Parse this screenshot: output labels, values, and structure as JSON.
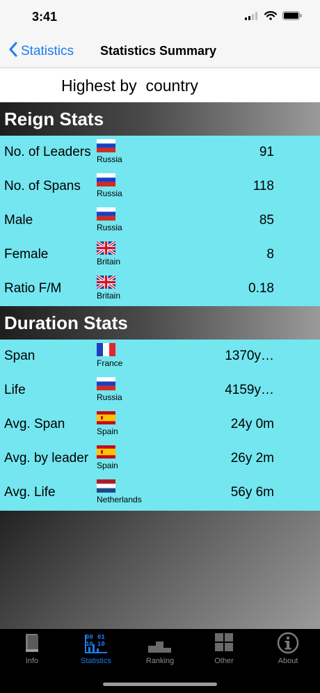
{
  "status": {
    "time": "3:41"
  },
  "nav": {
    "back_label": "Statistics",
    "title": "Statistics Summary"
  },
  "subtitle": "Highest by  country",
  "reign": {
    "header": "Reign Stats",
    "rows": [
      {
        "label": "No. of Leaders",
        "flag": "russia",
        "country": "Russia",
        "value": "91"
      },
      {
        "label": "No. of Spans",
        "flag": "russia",
        "country": "Russia",
        "value": "118"
      },
      {
        "label": "Male",
        "flag": "russia",
        "country": "Russia",
        "value": "85"
      },
      {
        "label": "Female",
        "flag": "britain",
        "country": "Britain",
        "value": "8"
      },
      {
        "label": "Ratio F/M",
        "flag": "britain",
        "country": "Britain",
        "value": "0.18"
      }
    ]
  },
  "duration": {
    "header": "Duration Stats",
    "rows": [
      {
        "label": "Span",
        "flag": "france",
        "country": "France",
        "value": "1370y…"
      },
      {
        "label": "Life",
        "flag": "russia",
        "country": "Russia",
        "value": "4159y…"
      },
      {
        "label": "Avg. Span",
        "flag": "spain",
        "country": "Spain",
        "value": "24y 0m"
      },
      {
        "label": "Avg. by leader",
        "flag": "spain",
        "country": "Spain",
        "value": "26y 2m"
      },
      {
        "label": "Avg. Life",
        "flag": "netherlands",
        "country": "Netherlands",
        "value": "56y 6m"
      }
    ]
  },
  "tabs": [
    {
      "label": "Info",
      "icon": "book-icon",
      "active": false
    },
    {
      "label": "Statistics",
      "icon": "statistics-icon",
      "active": true
    },
    {
      "label": "Ranking",
      "icon": "podium-icon",
      "active": false
    },
    {
      "label": "Other",
      "icon": "grid-icon",
      "active": false
    },
    {
      "label": "About",
      "icon": "info-icon",
      "active": false
    }
  ],
  "colors": {
    "accent": "#1a7ef0",
    "row_bg": "#74e6ef",
    "tab_bar": "#000000"
  }
}
